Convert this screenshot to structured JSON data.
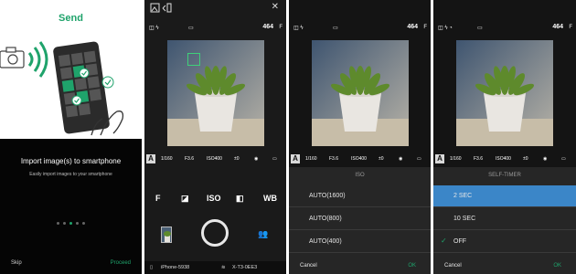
{
  "panel1": {
    "title": "Send",
    "heading": "Import image(s) to smartphone",
    "subtitle": "Easily import images to your smartphone",
    "skip": "Skip",
    "proceed": "Proceed",
    "accent": "#1fa36b"
  },
  "camera": {
    "shots": "464",
    "mode": "A",
    "shutter": "1/160",
    "aperture": "F3.6",
    "iso": "ISO400",
    "ev": "±0"
  },
  "panel2": {
    "settings": [
      "F",
      "◪",
      "ISO",
      "◧",
      "WB"
    ],
    "device_name": "iPhone-5938",
    "camera_name": "X-T3-0EE3"
  },
  "panel3": {
    "sheet_title": "ISO",
    "options": [
      "AUTO(1600)",
      "AUTO(800)",
      "AUTO(400)"
    ],
    "cancel": "Cancel",
    "ok": "OK"
  },
  "panel4": {
    "sheet_title": "SELF-TIMER",
    "options": [
      "2 SEC",
      "10 SEC",
      "OFF"
    ],
    "cancel": "Cancel",
    "ok": "OK",
    "selected_color": "#3b86c8"
  }
}
